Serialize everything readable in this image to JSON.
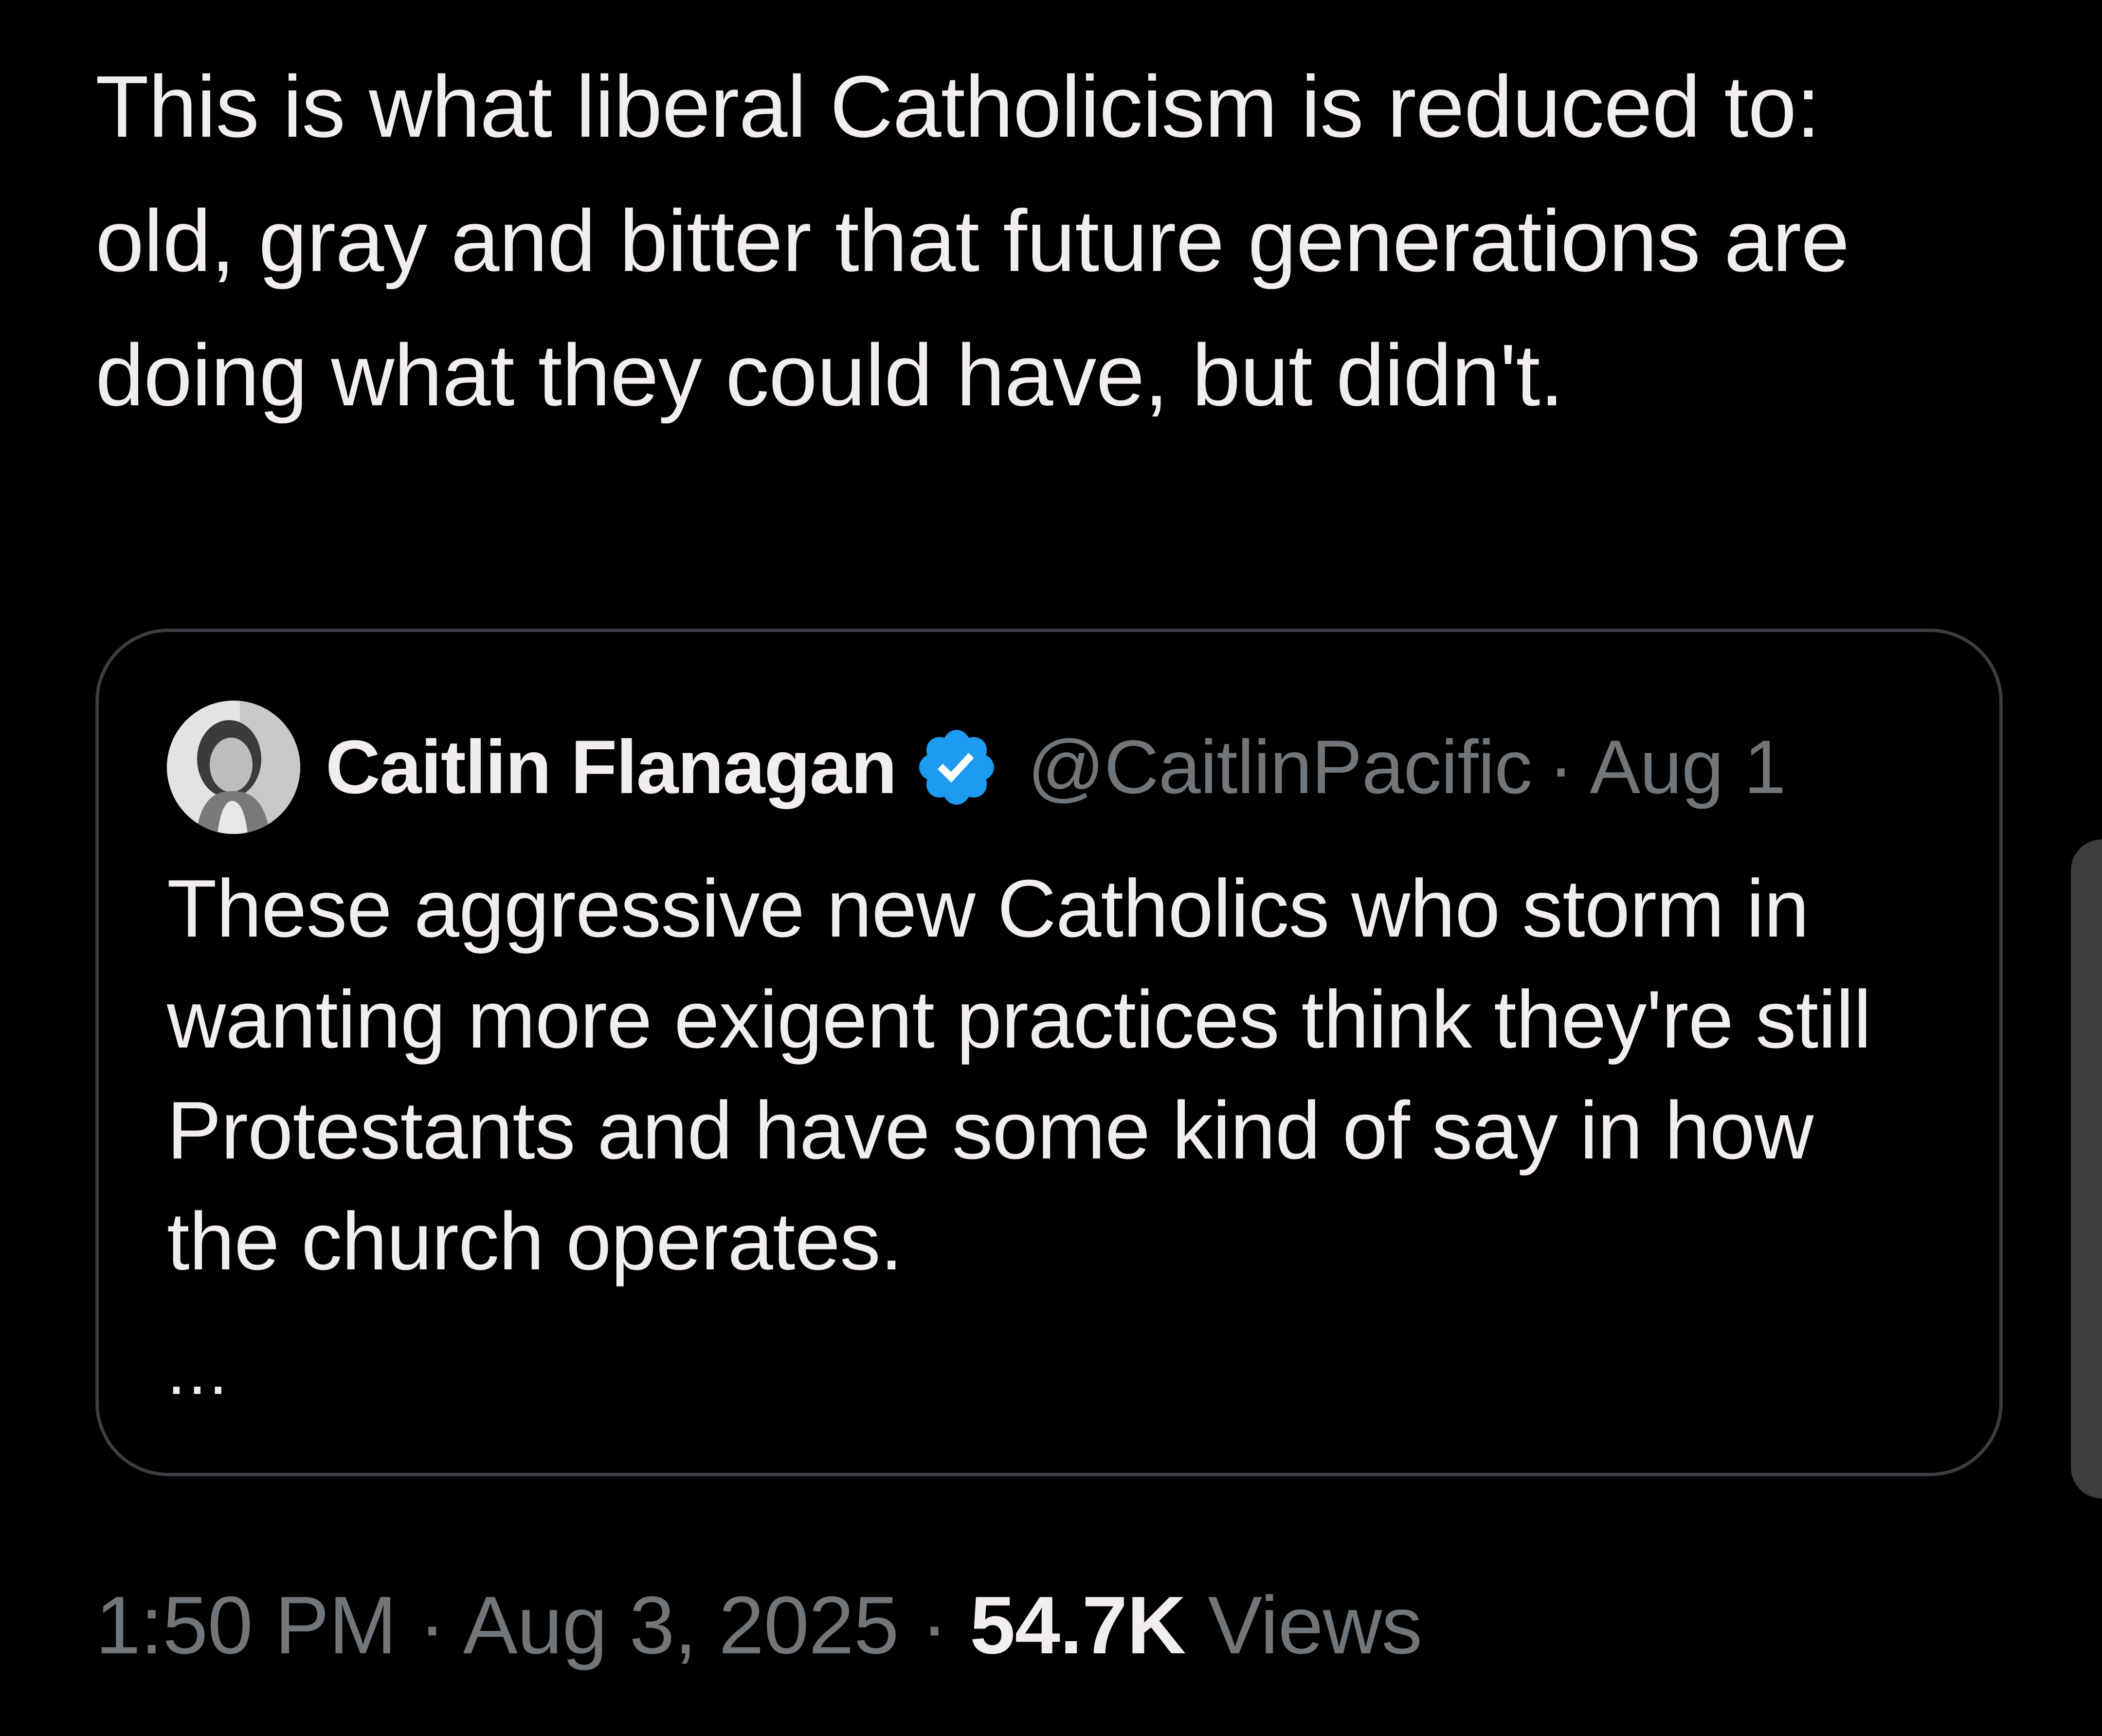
{
  "tweet": {
    "text": "This is what liberal Catholicism is reduced to:  old, gray and bitter that future generations are doing what they could have, but didn't."
  },
  "quoted_tweet": {
    "author_name": "Caitlin Flanagan",
    "verified": true,
    "handle": "@CaitlinPacific",
    "separator": "·",
    "date": "Aug 1",
    "text": "These aggressive new Catholics who storm in wanting more exigent practices think they're still Protestants and have some kind of say in how the church operates.",
    "truncation": "..."
  },
  "meta": {
    "time": "1:50 PM",
    "separator": "·",
    "date": "Aug 3, 2025",
    "views_count": "54.7K",
    "views_label": "Views"
  },
  "colors": {
    "background": "#000000",
    "text_primary": "#f2edf0",
    "text_secondary": "#71767b",
    "verified_badge": "#1d9bf0",
    "card_border": "#3a3d41"
  }
}
